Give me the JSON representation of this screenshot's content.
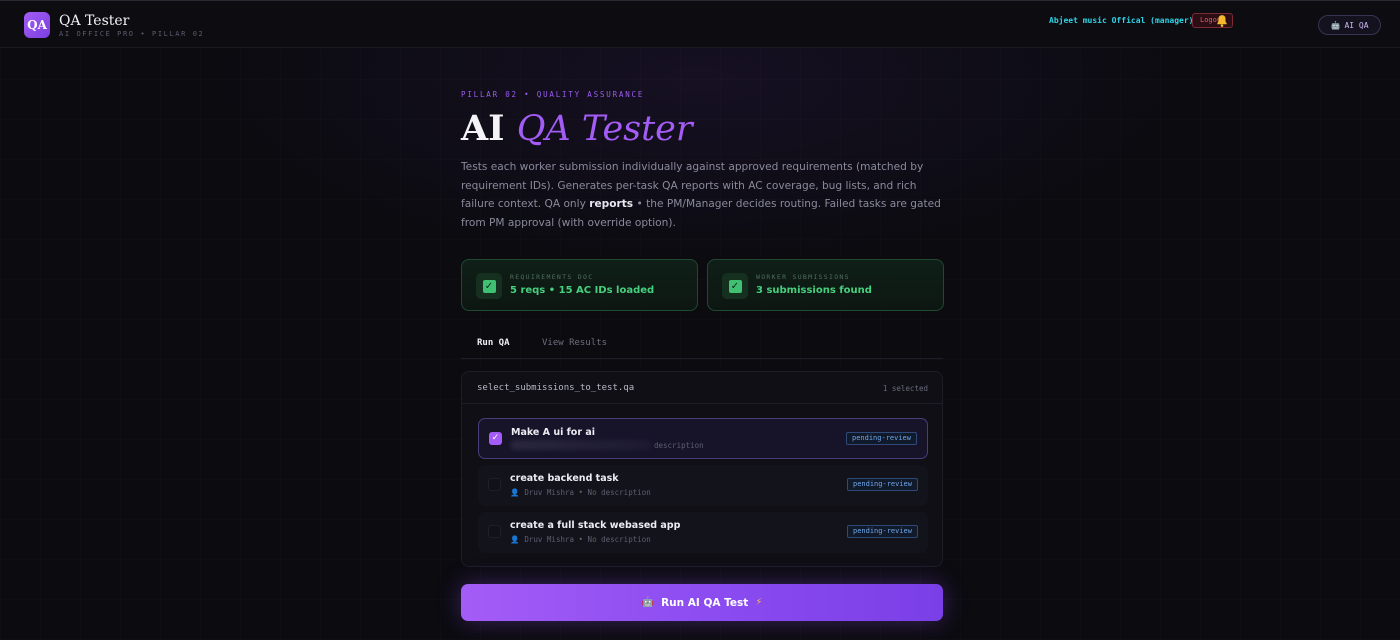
{
  "header": {
    "logo_text": "QA",
    "app_title": "QA Tester",
    "app_subtitle": "AI OFFICE PRO • PILLAR 02",
    "user": "Abjeet music Offical (manager)",
    "logout_label": "Logout",
    "ai_qa_label": "AI QA"
  },
  "hero": {
    "kicker": "PILLAR 02 • QUALITY ASSURANCE",
    "title_plain": "AI",
    "title_accent": "QA Tester",
    "desc_part1": "Tests each worker submission individually against approved requirements (matched by requirement IDs). Generates per-task QA reports with AC coverage, bug lists, and rich failure context. QA only ",
    "desc_bold": "reports",
    "desc_part2": " • the PM/Manager decides routing. Failed tasks are gated from PM approval (with override option)."
  },
  "stats": [
    {
      "label": "REQUIREMENTS DOC",
      "value": "5 reqs • 15 AC IDs loaded"
    },
    {
      "label": "WORKER SUBMISSIONS",
      "value": "3 submissions found"
    }
  ],
  "tabs": [
    {
      "label": "Run QA",
      "active": true
    },
    {
      "label": "View Results",
      "active": false
    }
  ],
  "panel": {
    "title": "select_submissions_to_test.qa",
    "count": "1 selected",
    "items": [
      {
        "title": "Make A ui for ai",
        "meta": "description",
        "badge": "pending-review",
        "selected": true
      },
      {
        "title": "create backend task",
        "author": "Druv Mishra",
        "meta": "• No description",
        "badge": "pending-review",
        "selected": false
      },
      {
        "title": "create a full stack webased app",
        "author": "Druv Mishra",
        "meta": "• No description",
        "badge": "pending-review",
        "selected": false
      }
    ]
  },
  "run_button": {
    "label": "Run AI QA Test"
  },
  "colors": {
    "accent": "#a35cf5",
    "success": "#46d07e",
    "badge": "#6fa6e8"
  },
  "icons": [
    "logo-icon",
    "bell-icon",
    "robot-icon",
    "check-icon",
    "person-icon",
    "bolt-icon"
  ]
}
